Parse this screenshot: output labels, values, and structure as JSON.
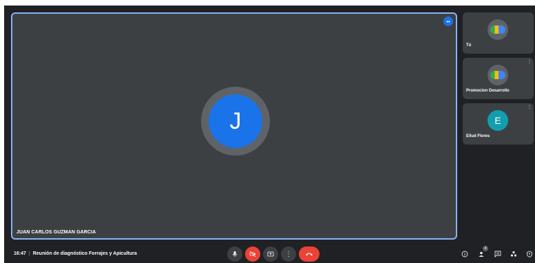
{
  "main_participant": {
    "initial": "J",
    "name": "JUAN CARLOS GUZMAN GARCIA",
    "avatar_color": "#1a73e8"
  },
  "side_participants": [
    {
      "name": "Tú",
      "avatar": "logo"
    },
    {
      "name": "Promocion Desarrollo",
      "avatar": "logo"
    },
    {
      "name": "Ellud Flores",
      "avatar": "initial",
      "initial": "E",
      "avatar_color": "#129eaf"
    }
  ],
  "meeting": {
    "time": "16:47",
    "separator": "|",
    "title": "Reunión de diagnóstico Forrajes y Apicultura"
  },
  "controls": {
    "mic_icon": "microphone-icon",
    "camera_icon": "camera-off-icon",
    "present_icon": "present-screen-icon",
    "more_icon": "more-options-icon",
    "hangup_icon": "hang-up-icon"
  },
  "right_controls": {
    "people_count": "4"
  },
  "colors": {
    "background": "#202124",
    "tile": "#3c4043",
    "active_border": "#8ab4f8",
    "danger": "#ea4335"
  }
}
